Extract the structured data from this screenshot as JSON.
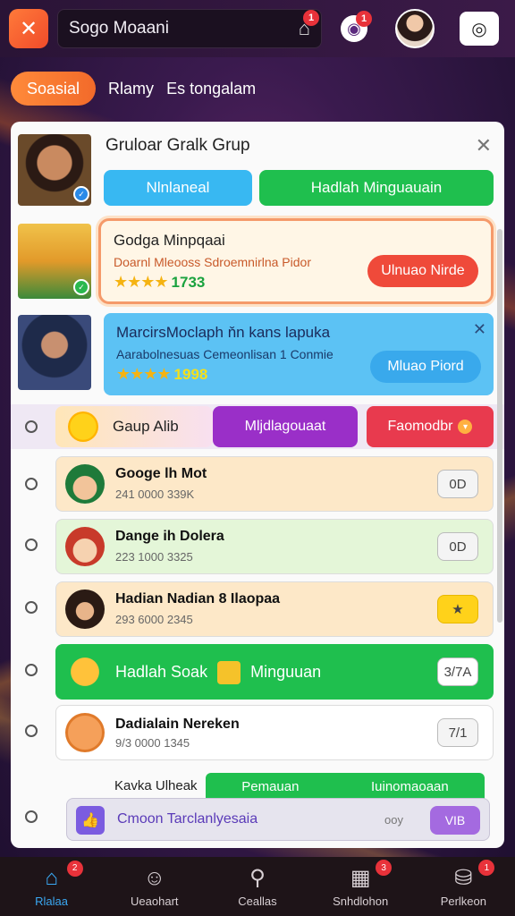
{
  "topbar": {
    "search_text": "Sogo Moaani",
    "home_badge": "1",
    "notif_badge": "1",
    "camera_icon": "camera-icon"
  },
  "tabs": {
    "active": "Soasial",
    "items": [
      "Rlamy",
      "Es tongalam"
    ]
  },
  "panel": {
    "title": "Gruloar Gralk Grup",
    "btn_blue": "Nlnlaneal",
    "btn_green": "Hadlah Minguauain"
  },
  "featured": [
    {
      "title": "Godga Minpqaai",
      "subtitle": "Doarnl Mleooss Sdroemnirlna Pidor",
      "stars": "★★★★",
      "score": "1733",
      "button": "Ulnuao Nirde"
    },
    {
      "title": "MarcirsMoclaph ňn kans lapuka",
      "subtitle": "Aarabolnesuas Cemeonlisan 1 Conmie",
      "stars": "★★★★",
      "score": "1998",
      "button": "Mluao Piord"
    }
  ],
  "group": {
    "label": "Gaup Alib",
    "btn_purple": "Mljdlagouaat",
    "btn_rose": "Faomodbr"
  },
  "list": [
    {
      "title": "Googe lh Mot",
      "sub": "241 0000 339K",
      "btn": "0D"
    },
    {
      "title": "Dange ih Dolera",
      "sub": "223 1000 3325",
      "btn": "0D"
    },
    {
      "title": "Hadian Nadian 8 Ilaopaa",
      "sub": "293 6000 2345",
      "btn": ""
    },
    {
      "title": "Hadlah Soak",
      "title2": "Minguuan",
      "btn": "3/7A"
    },
    {
      "title": "Dadialain Nereken",
      "sub": "9/3 0000 1345",
      "btn": "7/1"
    }
  ],
  "overlay": {
    "partial_title": "Kavka Ulheak",
    "green_left": "Pemauan",
    "green_right": "Iuinomaoaan"
  },
  "floatbar": {
    "text": "Cmoon Tarclanlyesaia",
    "small": "ooy",
    "btn": "VIB"
  },
  "nav": [
    {
      "label": "Rlalaa",
      "icon": "home-icon",
      "badge": "2"
    },
    {
      "label": "Ueaohart",
      "icon": "people-icon",
      "badge": ""
    },
    {
      "label": "Ceallas",
      "icon": "search-people-icon",
      "badge": ""
    },
    {
      "label": "Snhdlohon",
      "icon": "grid-icon",
      "badge": "3"
    },
    {
      "label": "Perlkeon",
      "icon": "bag-icon",
      "badge": "1"
    }
  ],
  "colors": {
    "accent_orange": "#f26a2a",
    "green": "#1fbf4e",
    "blue": "#38b8f2",
    "purple": "#9a2fc8",
    "rose": "#e83a4e"
  }
}
